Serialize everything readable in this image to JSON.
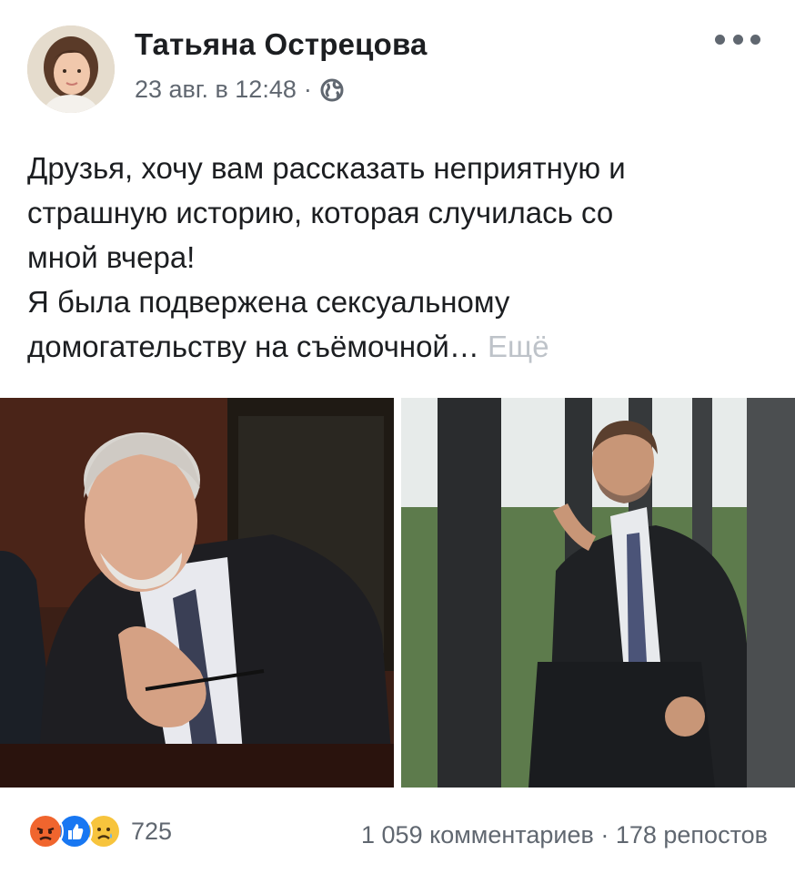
{
  "post": {
    "author": "Татьяна Острецова",
    "date": "23 авг. в 12:48",
    "separator": "·",
    "privacy_icon": "globe-icon",
    "more_icon": "more-dots-icon",
    "text_lines": [
      "Друзья, хочу вам рассказать неприятную и",
      "страшную историю, которая случилась со",
      "мной вчера!",
      "Я была подвержена сексуальному",
      "домогательству на съёмочной…"
    ],
    "see_more": "Ещё"
  },
  "photos": [
    {
      "name": "photo-left",
      "description": "older grey-haired bearded man in dark suit holding glasses at a desk"
    },
    {
      "name": "photo-right",
      "description": "bearded man in dark suit seated by large office window"
    }
  ],
  "footer": {
    "reactions": [
      "angry-reaction-icon",
      "like-reaction-icon",
      "sad-reaction-icon"
    ],
    "reaction_count": "725",
    "comments": "1 059 комментариев",
    "dot": "·",
    "shares": "178 репостов"
  },
  "colors": {
    "text": "#1c1e21",
    "secondary": "#606770",
    "see_more": "#bec3c9",
    "like_blue": "#1877f2",
    "angry_orange": "#f0652e",
    "sad_yellow": "#f7c43d"
  }
}
